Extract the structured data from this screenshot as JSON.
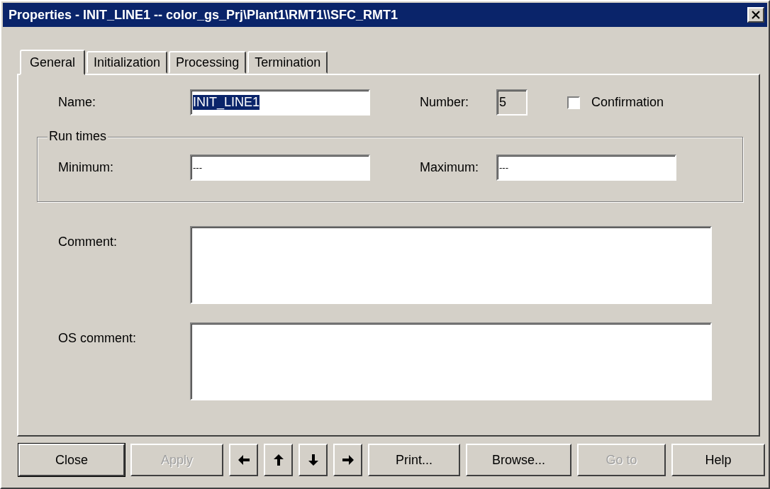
{
  "window": {
    "title": "Properties -  INIT_LINE1 -- color_gs_Prj\\Plant1\\RMT1\\\\SFC_RMT1"
  },
  "tabs": [
    {
      "label": "General",
      "selected": true
    },
    {
      "label": "Initialization",
      "selected": false
    },
    {
      "label": "Processing",
      "selected": false
    },
    {
      "label": "Termination",
      "selected": false
    }
  ],
  "name": {
    "label": "Name:",
    "value": "INIT_LINE1",
    "highlighted": true
  },
  "number": {
    "label": "Number:",
    "value": "5"
  },
  "confirmation": {
    "label": "Confirmation",
    "checked": false
  },
  "run_times": {
    "title": "Run times",
    "minimum": {
      "label": "Minimum:",
      "value": "---"
    },
    "maximum": {
      "label": "Maximum:",
      "value": "---"
    }
  },
  "comment": {
    "label": "Comment:"
  },
  "os_comment": {
    "label": "OS comment:"
  },
  "buttons": [
    {
      "kind": "text",
      "label": "Close",
      "disabled": false,
      "default": true
    },
    {
      "kind": "text",
      "label": "Apply",
      "disabled": true,
      "default": false
    },
    {
      "kind": "arrow-left",
      "disabled": false,
      "default": false
    },
    {
      "kind": "arrow-up",
      "disabled": false,
      "default": false
    },
    {
      "kind": "arrow-down",
      "disabled": false,
      "default": false
    },
    {
      "kind": "arrow-right",
      "disabled": false,
      "default": false
    },
    {
      "kind": "text",
      "label": "Print...",
      "disabled": false,
      "default": false
    },
    {
      "kind": "text",
      "label": "Browse...",
      "disabled": false,
      "default": false
    },
    {
      "kind": "text",
      "label": "Go to",
      "disabled": true,
      "default": false
    },
    {
      "kind": "text",
      "label": "Help",
      "disabled": false,
      "default": false
    }
  ]
}
